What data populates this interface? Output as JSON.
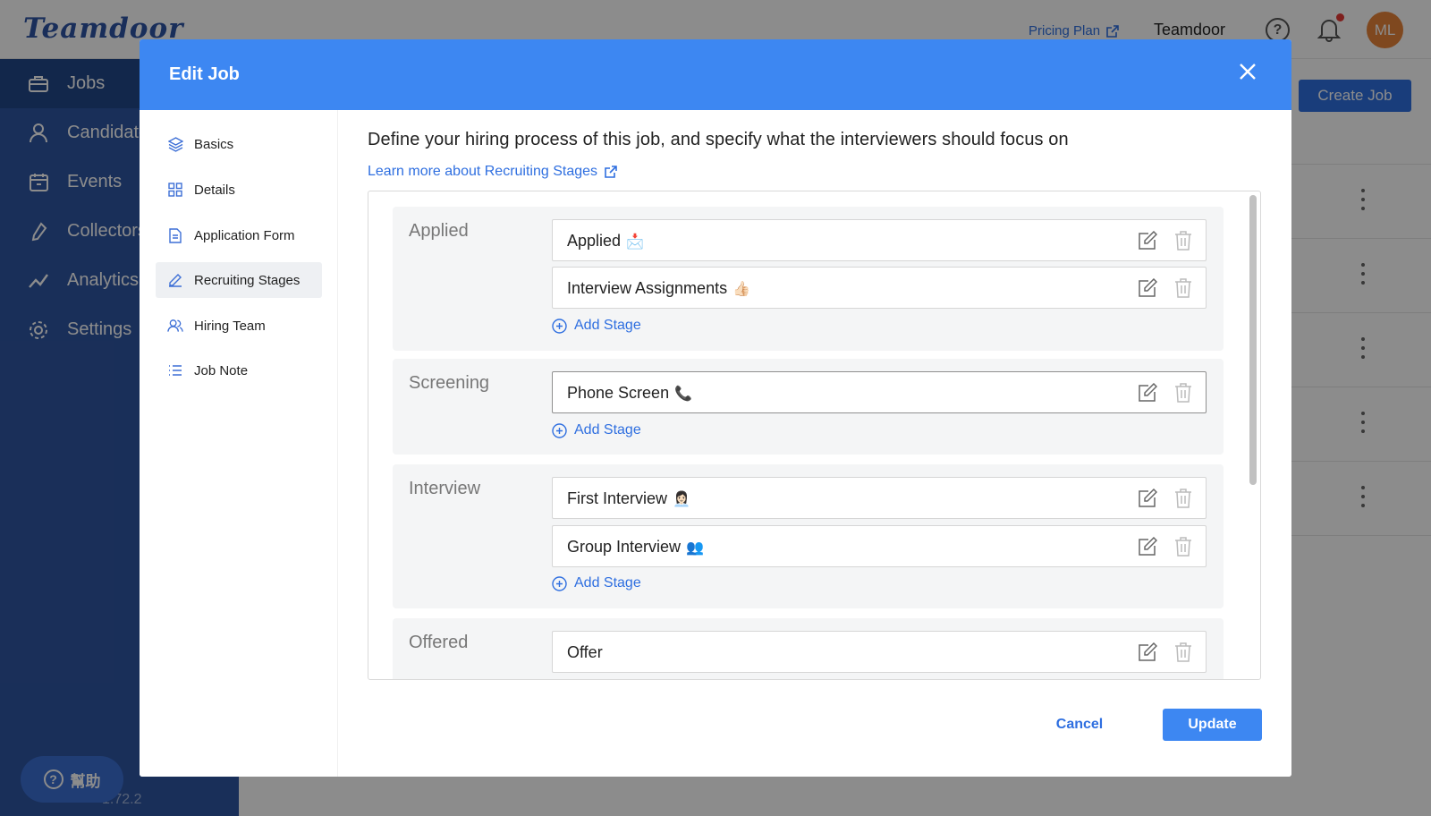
{
  "app": {
    "logo": "Teamdoor",
    "pricing_label": "Pricing Plan",
    "org_name": "Teamdoor",
    "avatar_initials": "ML",
    "version": "1.72.2",
    "help_label": "幫助",
    "create_job_label": "Create Job",
    "accent_color": "#2f6fe0",
    "sidebar_color": "#2f56a3"
  },
  "sidebar": {
    "items": [
      {
        "label": "Jobs",
        "icon": "briefcase-icon",
        "active": true
      },
      {
        "label": "Candidates",
        "icon": "person-icon"
      },
      {
        "label": "Events",
        "icon": "calendar-icon"
      },
      {
        "label": "Collectors",
        "icon": "link-icon"
      },
      {
        "label": "Analytics",
        "icon": "trend-icon"
      },
      {
        "label": "Settings",
        "icon": "gear-icon"
      }
    ]
  },
  "modal": {
    "title": "Edit Job",
    "nav": [
      {
        "label": "Basics",
        "icon": "layers-icon"
      },
      {
        "label": "Details",
        "icon": "grid-icon"
      },
      {
        "label": "Application Form",
        "icon": "document-icon"
      },
      {
        "label": "Recruiting Stages",
        "icon": "pencil-icon",
        "active": true
      },
      {
        "label": "Hiring Team",
        "icon": "team-icon"
      },
      {
        "label": "Job Note",
        "icon": "list-icon"
      }
    ],
    "description": "Define your hiring process of this job, and specify what the interviewers should focus on",
    "learn_more": "Learn more about Recruiting Stages",
    "add_stage_label": "Add Stage",
    "groups": [
      {
        "label": "Applied",
        "stages": [
          {
            "name": "Applied",
            "emoji": "📩"
          },
          {
            "name": "Interview Assignments",
            "emoji": "👍🏻"
          }
        ]
      },
      {
        "label": "Screening",
        "stages": [
          {
            "name": "Phone Screen",
            "emoji": "📞"
          }
        ]
      },
      {
        "label": "Interview",
        "stages": [
          {
            "name": "First Interview",
            "emoji": "👩🏻‍💼"
          },
          {
            "name": "Group Interview",
            "emoji": "👥"
          }
        ]
      },
      {
        "label": "Offered",
        "stages": [
          {
            "name": "Offer",
            "emoji": ""
          }
        ]
      }
    ],
    "cancel_label": "Cancel",
    "update_label": "Update"
  }
}
